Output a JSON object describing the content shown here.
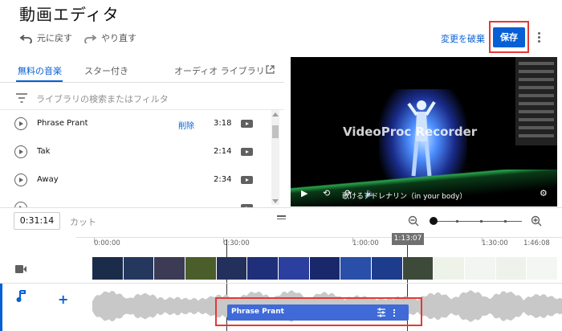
{
  "header": {
    "title": "動画エディタ",
    "undo": "元に戻す",
    "redo": "やり直す",
    "discard": "変更を破棄",
    "save": "保存"
  },
  "tabs": {
    "free_music": "無料の音楽",
    "starred": "スター付き",
    "audio_library": "オーディオ ライブラリ"
  },
  "filter": {
    "placeholder": "ライブラリの検索またはフィルタ"
  },
  "tracks": [
    {
      "name": "Phrase Prant",
      "action": "削除",
      "duration": "3:18"
    },
    {
      "name": "Tak",
      "action": "",
      "duration": "2:14"
    },
    {
      "name": "Away",
      "action": "",
      "duration": "2:34"
    },
    {
      "name": "",
      "action": "",
      "duration": ""
    }
  ],
  "video": {
    "watermark": "VideoProc Recorder",
    "subtitle": "歌けるアドレナリン（in your body）"
  },
  "timeline": {
    "current_time": "0:31:14",
    "cut": "カット",
    "playhead_time": "1:13:07",
    "ruler": [
      "0:00:00",
      "0:30:00",
      "1:00:00",
      "1:30:00",
      "1:46:08"
    ],
    "audio_clip": "Phrase Prant"
  },
  "colors": {
    "accent": "#065fd4",
    "highlight": "#e53935",
    "clip": "#3f6ad8"
  }
}
